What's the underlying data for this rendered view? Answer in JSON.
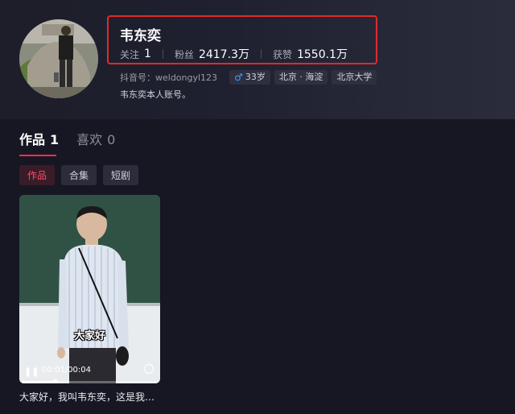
{
  "profile": {
    "nickname": "韦东奕",
    "stats": [
      {
        "label": "关注",
        "value": "1"
      },
      {
        "label": "粉丝",
        "value": "2417.3万"
      },
      {
        "label": "获赞",
        "value": "1550.1万"
      }
    ],
    "douyin_id": "抖音号：weldongyl123",
    "tags": {
      "gender_icon": "male-icon",
      "age": "33岁",
      "location": "北京 · 海淀",
      "school": "北京大学"
    },
    "bio": "韦东奕本人账号。"
  },
  "tabs": [
    {
      "label": "作品",
      "count": "1",
      "active": true
    },
    {
      "label": "喜欢",
      "count": "0",
      "active": false
    }
  ],
  "chips": [
    {
      "label": "作品",
      "active": true
    },
    {
      "label": "合集",
      "active": false
    },
    {
      "label": "短剧",
      "active": false
    }
  ],
  "video": {
    "caption_overlay": "大家好",
    "time": "00:01/00:04",
    "progress": 0.25,
    "title": "大家好，我叫韦东奕，这是我…"
  },
  "colors": {
    "accent": "#fe2c55",
    "highlight_box": "#e02a2a",
    "background": "#161722"
  }
}
